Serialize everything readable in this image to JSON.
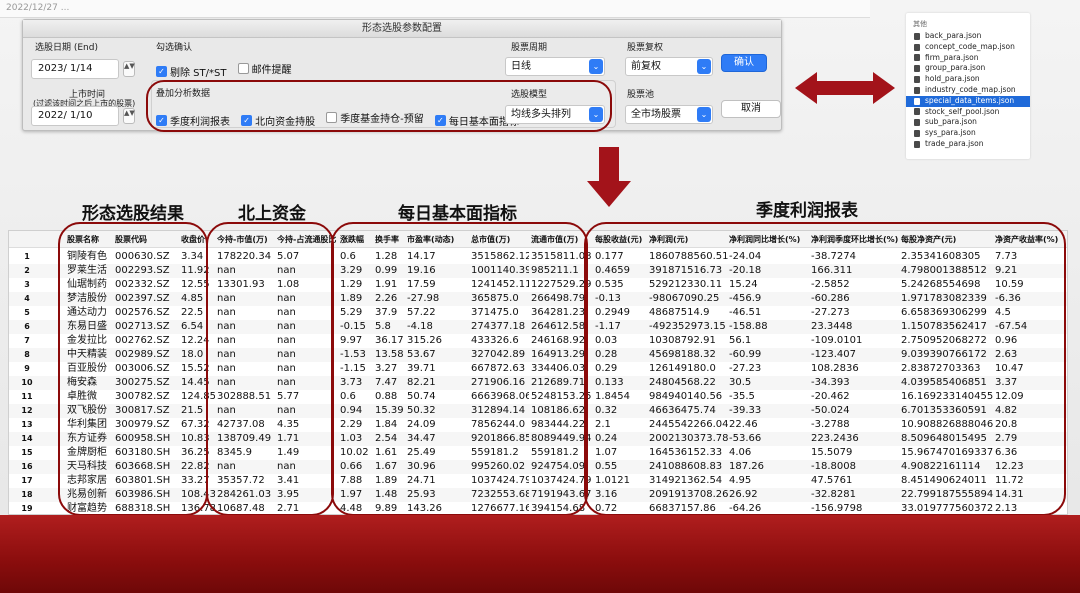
{
  "top_strip": {
    "text": "2022/12/27 ..."
  },
  "dialog": {
    "title": "形态选股参数配置",
    "select_date_label": "选股日期 (End)",
    "select_date_value": "2023/  1/14",
    "listing_date_label": "上市时间",
    "listing_date_sublabel": "(过滤该时间之后上市的股票)",
    "listing_date_value": "2022/  1/10",
    "stepper_glyph": "▲▼",
    "check_confirm_label": "勾选确认",
    "chk_remove_st": "剔除 ST/*ST",
    "chk_email": "邮件提醒",
    "overlay_label": "叠加分析数据",
    "chk_quarterly_profit": "季度利润报表",
    "chk_northbound": "北向资金持股",
    "chk_fund_holding": "季度基金持仓-预留",
    "chk_daily_basic": "每日基本面指标",
    "period_label": "股票周期",
    "period_value": "日线",
    "adjust_label": "股票复权",
    "adjust_value": "前复权",
    "model_label": "选股模型",
    "model_value": "均线多头排列",
    "pool_label": "股票池",
    "pool_value": "全市场股票",
    "confirm_button": "确认",
    "cancel_button": "取消",
    "check_glyph": "✓",
    "select_glyph": "⌄"
  },
  "file_list": {
    "header": "其他",
    "files": [
      "back_para.json",
      "concept_code_map.json",
      "firm_para.json",
      "group_para.json",
      "hold_para.json",
      "industry_code_map.json",
      "special_data_items.json",
      "stock_self_pool.json",
      "sub_para.json",
      "sys_para.json",
      "trade_para.json"
    ],
    "selected_index": 6
  },
  "arrows": {
    "right_glyph": "⟷",
    "down_glyph": "▼"
  },
  "sections": {
    "pattern": "形态选股结果",
    "northbound": "北上资金",
    "daily": "每日基本面指标",
    "quarterly": "季度利润报表"
  },
  "table": {
    "headers": [
      "",
      "股票名称",
      "股票代码",
      "收盘价",
      "今持-市值(万)",
      "今持-占流通股比",
      "涨跌幅",
      "换手率",
      "市盈率(动态)",
      "总市值(万)",
      "流通市值(万)",
      "每股收益(元)",
      "净利润(元)",
      "净利润同比增长(%)",
      "净利润季度环比增长(%)",
      "每股净资产(元)",
      "净资产收益率(%)"
    ],
    "rows": [
      [
        "1",
        "铜陵有色",
        "000630.SZ",
        "3.34",
        "178220.34",
        "5.07",
        "0.6",
        "1.28",
        "14.17",
        "3515862.12",
        "3515811.08",
        "0.177",
        "1860788560.51",
        "-24.04",
        "-38.7274",
        "2.35341608305",
        "7.73"
      ],
      [
        "2",
        "罗莱生活",
        "002293.SZ",
        "11.92",
        "nan",
        "nan",
        "3.29",
        "0.99",
        "19.16",
        "1001140.39",
        "985211.1",
        "0.4659",
        "391871516.73",
        "-20.18",
        "166.311",
        "4.798001388512",
        "9.21"
      ],
      [
        "3",
        "仙琚制药",
        "002332.SZ",
        "12.55",
        "13301.93",
        "1.08",
        "1.29",
        "1.91",
        "17.59",
        "1241452.11",
        "1227529.29",
        "0.535",
        "529212330.11",
        "15.24",
        "-2.5852",
        "5.24268554698",
        "10.59"
      ],
      [
        "4",
        "梦洁股份",
        "002397.SZ",
        "4.85",
        "nan",
        "nan",
        "1.89",
        "2.26",
        "-27.98",
        "365875.0",
        "266498.79",
        "-0.13",
        "-98067090.25",
        "-456.9",
        "-60.286",
        "1.971783082339",
        "-6.36"
      ],
      [
        "5",
        "通达动力",
        "002576.SZ",
        "22.5",
        "nan",
        "nan",
        "5.29",
        "37.9",
        "57.22",
        "371475.0",
        "364281.23",
        "0.2949",
        "48687514.9",
        "-46.51",
        "-27.273",
        "6.658369306299",
        "4.5"
      ],
      [
        "6",
        "东易日盛",
        "002713.SZ",
        "6.54",
        "nan",
        "nan",
        "-0.15",
        "5.8",
        "-4.18",
        "274377.18",
        "264612.58",
        "-1.17",
        "-492352973.15",
        "-158.88",
        "23.3448",
        "1.150783562417",
        "-67.54"
      ],
      [
        "7",
        "金发拉比",
        "002762.SZ",
        "12.24",
        "nan",
        "nan",
        "9.97",
        "36.17",
        "315.26",
        "433326.6",
        "246168.92",
        "0.03",
        "10308792.91",
        "56.1",
        "-109.0101",
        "2.750952068272",
        "0.96"
      ],
      [
        "8",
        "中天精装",
        "002989.SZ",
        "18.0",
        "nan",
        "nan",
        "-1.53",
        "13.58",
        "53.67",
        "327042.89",
        "164913.29",
        "0.28",
        "45698188.32",
        "-60.99",
        "-123.407",
        "9.039390766172",
        "2.63"
      ],
      [
        "9",
        "百亚股份",
        "003006.SZ",
        "15.52",
        "nan",
        "nan",
        "-1.15",
        "3.27",
        "39.71",
        "667872.63",
        "334406.03",
        "0.29",
        "126149180.0",
        "-27.23",
        "108.2836",
        "2.83872703363",
        "10.47"
      ],
      [
        "10",
        "梅安森",
        "300275.SZ",
        "14.45",
        "nan",
        "nan",
        "3.73",
        "7.47",
        "82.21",
        "271906.16",
        "212689.71",
        "0.133",
        "24804568.22",
        "30.5",
        "-34.393",
        "4.039585406851",
        "3.37"
      ],
      [
        "11",
        "卓胜微",
        "300782.SZ",
        "124.85",
        "302888.51",
        "5.77",
        "0.6",
        "0.88",
        "50.74",
        "6663968.06",
        "5248153.25",
        "1.8454",
        "984940140.56",
        "-35.5",
        "-20.462",
        "16.169233140455",
        "12.09"
      ],
      [
        "12",
        "双飞股份",
        "300817.SZ",
        "21.5",
        "nan",
        "nan",
        "0.94",
        "15.39",
        "50.32",
        "312894.14",
        "108186.62",
        "0.32",
        "46636475.74",
        "-39.33",
        "-50.024",
        "6.701353360591",
        "4.82"
      ],
      [
        "13",
        "华利集团",
        "300979.SZ",
        "67.32",
        "42737.08",
        "4.35",
        "2.29",
        "1.84",
        "24.09",
        "7856244.0",
        "983444.22",
        "2.1",
        "2445542266.04",
        "22.46",
        "-3.2788",
        "10.908826888046",
        "20.8"
      ],
      [
        "14",
        "东方证券",
        "600958.SH",
        "10.83",
        "138709.49",
        "1.71",
        "1.03",
        "2.54",
        "34.47",
        "9201866.85",
        "8089449.94",
        "0.24",
        "2002130373.78",
        "-53.66",
        "223.2436",
        "8.509648015495",
        "2.79"
      ],
      [
        "15",
        "金牌厨柜",
        "603180.SH",
        "36.25",
        "8345.9",
        "1.49",
        "10.02",
        "1.61",
        "25.49",
        "559181.2",
        "559181.2",
        "1.07",
        "164536152.33",
        "4.06",
        "15.5079",
        "15.967470169337",
        "6.36"
      ],
      [
        "16",
        "天马科技",
        "603668.SH",
        "22.82",
        "nan",
        "nan",
        "0.66",
        "1.67",
        "30.96",
        "995260.02",
        "924754.09",
        "0.55",
        "241088608.83",
        "187.26",
        "-18.8008",
        "4.90822161114",
        "12.23"
      ],
      [
        "17",
        "志邦家居",
        "603801.SH",
        "33.27",
        "35357.72",
        "3.41",
        "7.88",
        "1.89",
        "24.71",
        "1037424.79",
        "1037424.79",
        "1.0121",
        "314921362.54",
        "4.95",
        "47.5761",
        "8.451490624011",
        "11.72"
      ],
      [
        "18",
        "兆易创新",
        "603986.SH",
        "108.43",
        "284261.03",
        "3.95",
        "1.97",
        "1.48",
        "25.93",
        "7232553.68",
        "7191943.67",
        "3.16",
        "2091913708.26",
        "26.92",
        "-32.8281",
        "22.799187555894",
        "14.31"
      ],
      [
        "19",
        "财富趋势",
        "688318.SH",
        "136.78",
        "10687.48",
        "2.71",
        "4.48",
        "9.89",
        "143.26",
        "1276677.16",
        "394154.68",
        "0.72",
        "66837157.86",
        "-64.26",
        "-156.9798",
        "33.019777560372",
        "2.13"
      ]
    ]
  },
  "colors": {
    "accent": "#2f7cf6",
    "annotation_red": "#8b0a0a",
    "band_red": "#9a1414"
  }
}
